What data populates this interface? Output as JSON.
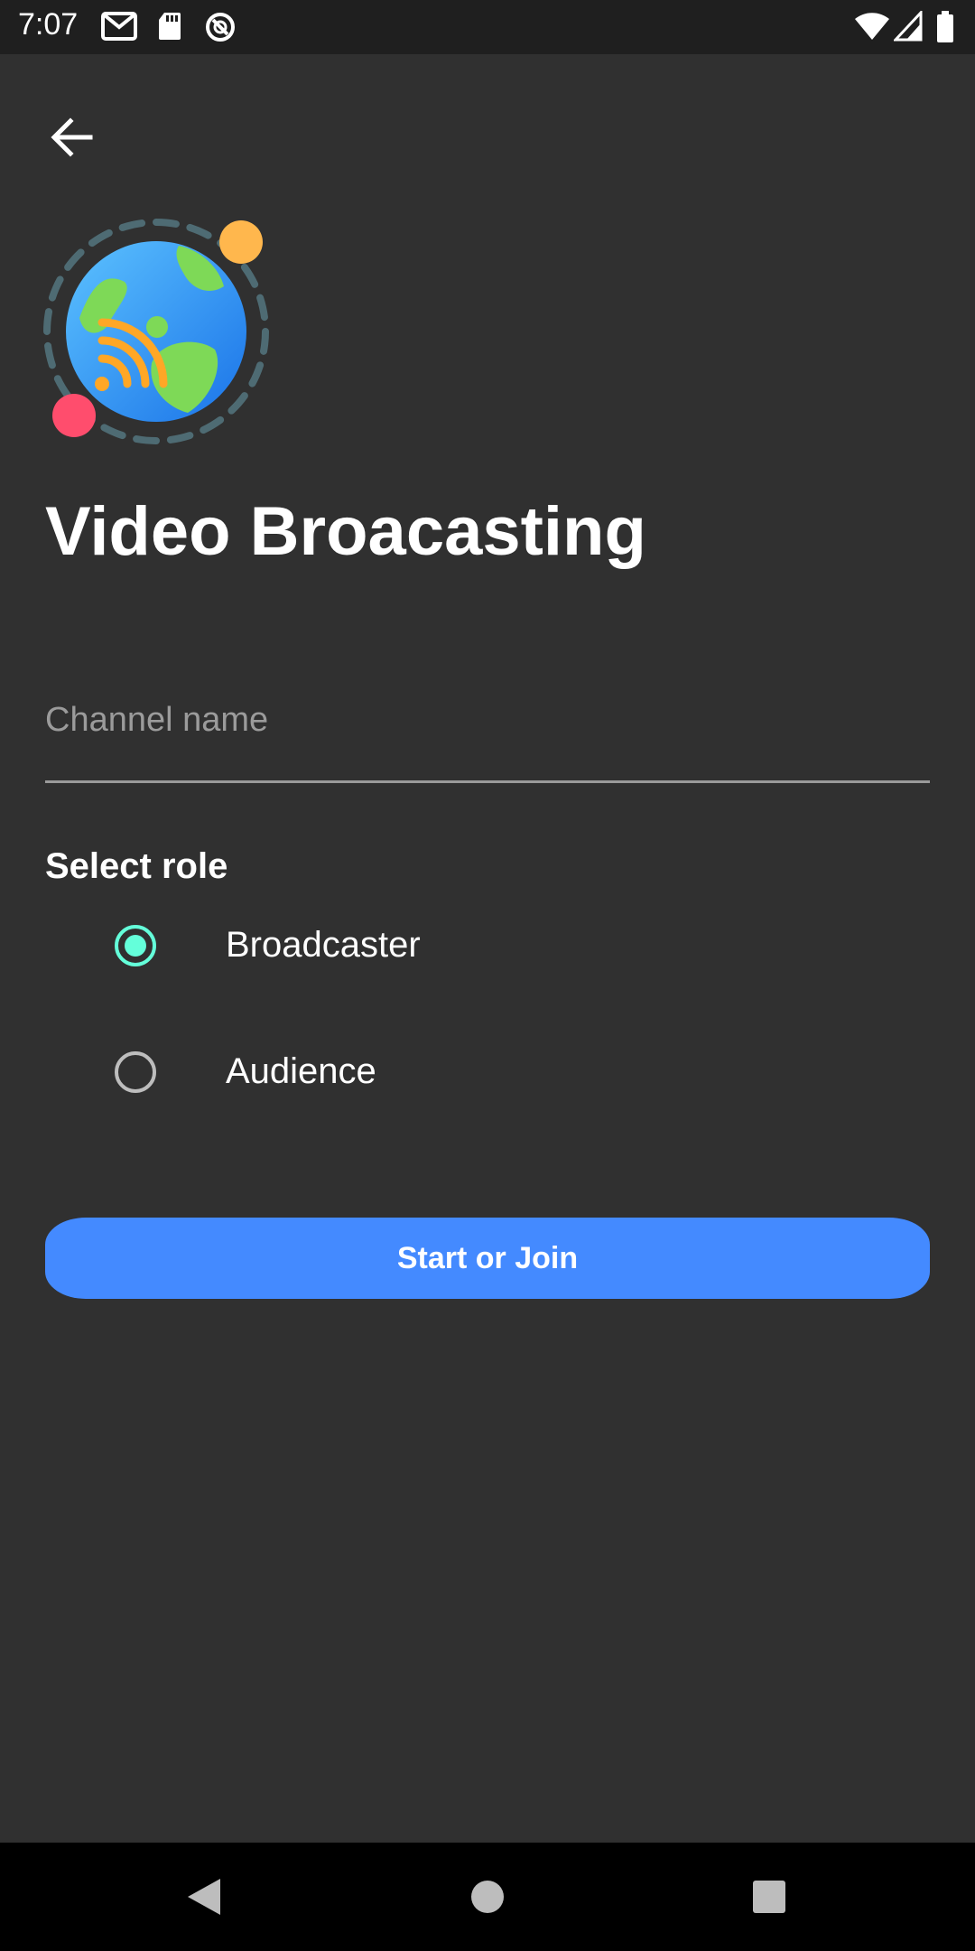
{
  "status_bar": {
    "time": "7:07",
    "left_icons": [
      "gmail-icon",
      "sd-card-icon",
      "vpn-icon"
    ],
    "right_icons": [
      "wifi-icon",
      "cell-signal-icon",
      "battery-icon"
    ]
  },
  "header": {
    "back_icon": "arrow-left-icon"
  },
  "logo": {
    "icon": "globe-broadcast-icon"
  },
  "page": {
    "title": "Video Broacasting"
  },
  "channel": {
    "placeholder": "Channel name",
    "value": ""
  },
  "role": {
    "section_label": "Select role",
    "options": [
      {
        "label": "Broadcaster",
        "selected": true
      },
      {
        "label": "Audience",
        "selected": false
      }
    ]
  },
  "actions": {
    "start_label": "Start or Join"
  },
  "nav_bar": {
    "icons": [
      "nav-back-icon",
      "nav-home-icon",
      "nav-recents-icon"
    ]
  },
  "colors": {
    "background": "#303030",
    "accent": "#64ffda",
    "button": "#448aff",
    "status_bar": "#1f1f1f"
  }
}
